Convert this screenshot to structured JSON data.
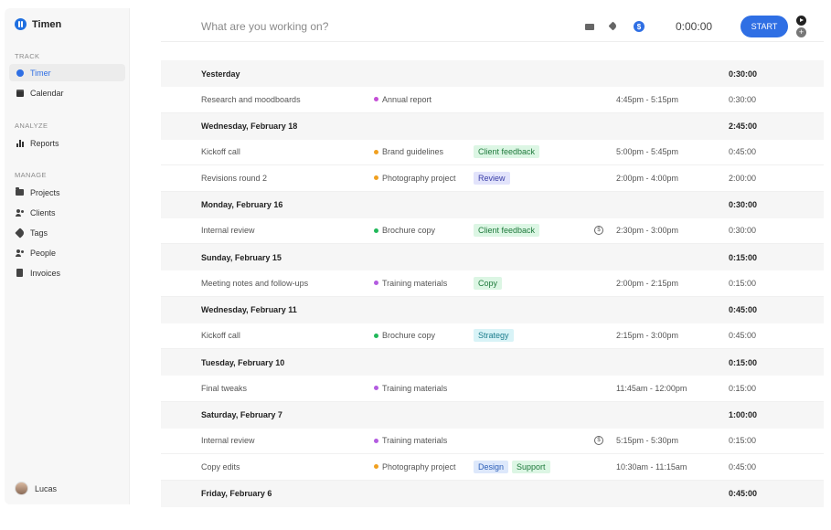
{
  "app": {
    "name": "Timen"
  },
  "sidebar": {
    "sections": [
      {
        "label": "TRACK",
        "items": [
          {
            "label": "Timer",
            "icon": "clock-icon",
            "active": true
          },
          {
            "label": "Calendar",
            "icon": "calendar-icon"
          }
        ]
      },
      {
        "label": "ANALYZE",
        "items": [
          {
            "label": "Reports",
            "icon": "bar-chart-icon"
          }
        ]
      },
      {
        "label": "MANAGE",
        "items": [
          {
            "label": "Projects",
            "icon": "folder-icon"
          },
          {
            "label": "Clients",
            "icon": "clients-icon"
          },
          {
            "label": "Tags",
            "icon": "tag-icon"
          },
          {
            "label": "People",
            "icon": "people-icon"
          },
          {
            "label": "Invoices",
            "icon": "document-icon"
          }
        ]
      }
    ],
    "user": {
      "name": "Lucas"
    }
  },
  "topbar": {
    "placeholder": "What are you working on?",
    "timer": "0:00:00",
    "start_label": "START",
    "plus": "+"
  },
  "colors": {
    "accent": "#2f6fe4"
  },
  "groups": [
    {
      "date": "Yesterday",
      "total": "0:30:00",
      "entries": [
        {
          "desc": "Research and moodboards",
          "project": "Annual report",
          "project_color": "#c44fd6",
          "tags": [],
          "nonbillable": false,
          "time": "4:45pm  -  5:15pm",
          "duration": "0:30:00"
        }
      ]
    },
    {
      "date": "Wednesday, February 18",
      "total": "2:45:00",
      "entries": [
        {
          "desc": "Kickoff call",
          "project": "Brand guidelines",
          "project_color": "#f0a020",
          "tags": [
            {
              "label": "Client feedback",
              "bg": "#dcf6e4",
              "fg": "#1f7a3c"
            }
          ],
          "nonbillable": false,
          "time": "5:00pm  -  5:45pm",
          "duration": "0:45:00"
        },
        {
          "desc": "Revisions round 2",
          "project": "Photography project",
          "project_color": "#f0a020",
          "tags": [
            {
              "label": "Review",
              "bg": "#e2e3fb",
              "fg": "#3b3fa8"
            }
          ],
          "nonbillable": false,
          "time": "2:00pm  -  4:00pm",
          "duration": "2:00:00"
        }
      ]
    },
    {
      "date": "Monday, February 16",
      "total": "0:30:00",
      "entries": [
        {
          "desc": "Internal review",
          "project": "Brochure copy",
          "project_color": "#21b85a",
          "tags": [
            {
              "label": "Client feedback",
              "bg": "#dcf6e4",
              "fg": "#1f7a3c"
            }
          ],
          "nonbillable": true,
          "time": "2:30pm  -  3:00pm",
          "duration": "0:30:00"
        }
      ]
    },
    {
      "date": "Sunday, February 15",
      "total": "0:15:00",
      "entries": [
        {
          "desc": "Meeting notes and follow-ups",
          "project": "Training materials",
          "project_color": "#b35ce0",
          "tags": [
            {
              "label": "Copy",
              "bg": "#dcf6e4",
              "fg": "#1f7a3c"
            }
          ],
          "nonbillable": false,
          "time": "2:00pm  -  2:15pm",
          "duration": "0:15:00"
        }
      ]
    },
    {
      "date": "Wednesday, February 11",
      "total": "0:45:00",
      "entries": [
        {
          "desc": "Kickoff call",
          "project": "Brochure copy",
          "project_color": "#21b85a",
          "tags": [
            {
              "label": "Strategy",
              "bg": "#d8f3f7",
              "fg": "#1b7c8c"
            }
          ],
          "nonbillable": false,
          "time": "2:15pm  -  3:00pm",
          "duration": "0:45:00"
        }
      ]
    },
    {
      "date": "Tuesday, February 10",
      "total": "0:15:00",
      "entries": [
        {
          "desc": "Final tweaks",
          "project": "Training materials",
          "project_color": "#b35ce0",
          "tags": [],
          "nonbillable": false,
          "time": "11:45am  -  12:00pm",
          "duration": "0:15:00"
        }
      ]
    },
    {
      "date": "Saturday, February 7",
      "total": "1:00:00",
      "entries": [
        {
          "desc": "Internal review",
          "project": "Training materials",
          "project_color": "#b35ce0",
          "tags": [],
          "nonbillable": true,
          "time": "5:15pm  -  5:30pm",
          "duration": "0:15:00"
        },
        {
          "desc": "Copy edits",
          "project": "Photography project",
          "project_color": "#f0a020",
          "tags": [
            {
              "label": "Design",
              "bg": "#dde8fb",
              "fg": "#2d5fb8"
            },
            {
              "label": "Support",
              "bg": "#dcf6e4",
              "fg": "#1f7a3c"
            }
          ],
          "nonbillable": false,
          "time": "10:30am  -  11:15am",
          "duration": "0:45:00"
        }
      ]
    },
    {
      "date": "Friday, February 6",
      "total": "0:45:00",
      "entries": []
    }
  ]
}
